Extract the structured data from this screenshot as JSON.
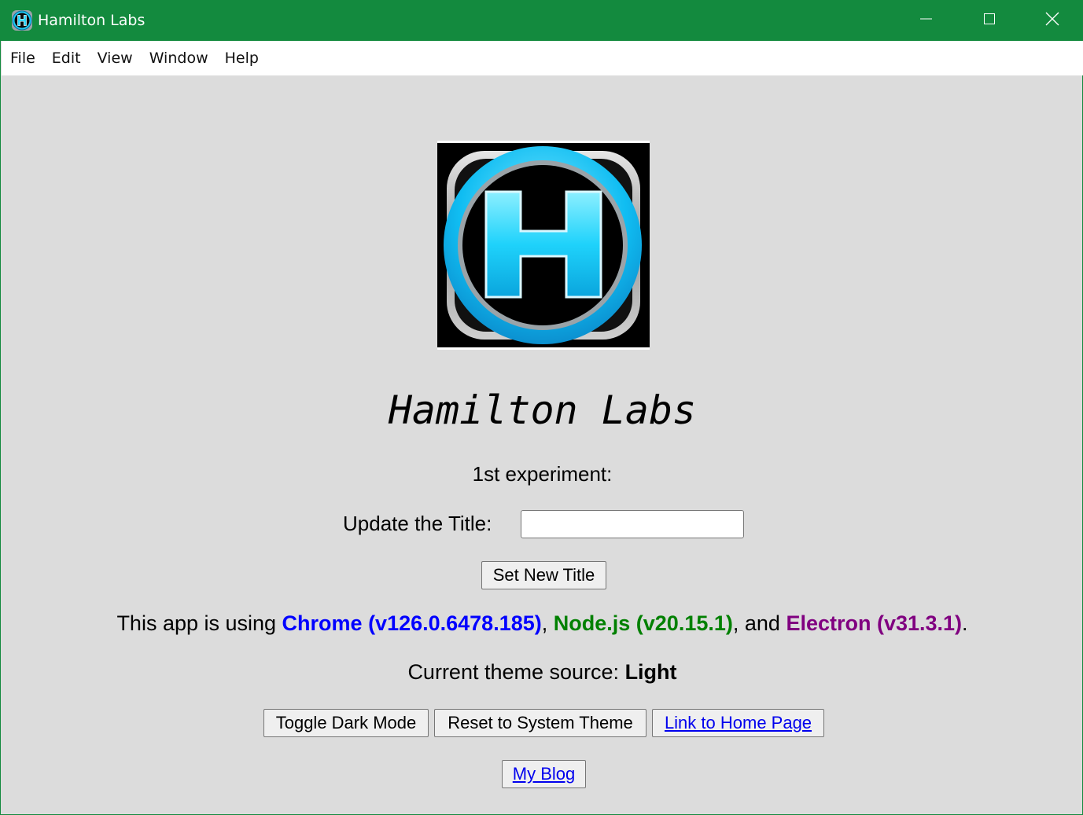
{
  "window": {
    "title": "Hamilton Labs",
    "accent_color": "#138a3e",
    "controls": [
      "minimize-icon",
      "maximize-icon",
      "close-icon"
    ]
  },
  "menu": {
    "items": [
      "File",
      "Edit",
      "View",
      "Window",
      "Help"
    ]
  },
  "logo": {
    "icon": "hamilton-labs-logo",
    "letter": "H"
  },
  "main": {
    "heading": "Hamilton Labs",
    "experiment_label": "1st experiment:",
    "title_label": "Update the Title:",
    "title_input_value": "",
    "set_title_button": "Set New Title",
    "info": {
      "prefix": "This app is using ",
      "chrome": "Chrome (v126.0.6478.185)",
      "sep1": ", ",
      "node": "Node.js (v20.15.1)",
      "sep2": ", and ",
      "electron": "Electron (v31.3.1)",
      "suffix": "."
    },
    "theme": {
      "label": "Current theme source: ",
      "value": "Light"
    },
    "buttons": {
      "toggle_dark": "Toggle Dark Mode",
      "reset_theme": "Reset to System Theme",
      "home_link": "Link to Home Page",
      "blog_link": "My Blog"
    }
  },
  "colors": {
    "chrome": "#0000ff",
    "node": "#008000",
    "electron": "#800080",
    "background": "#dcdcdc"
  }
}
